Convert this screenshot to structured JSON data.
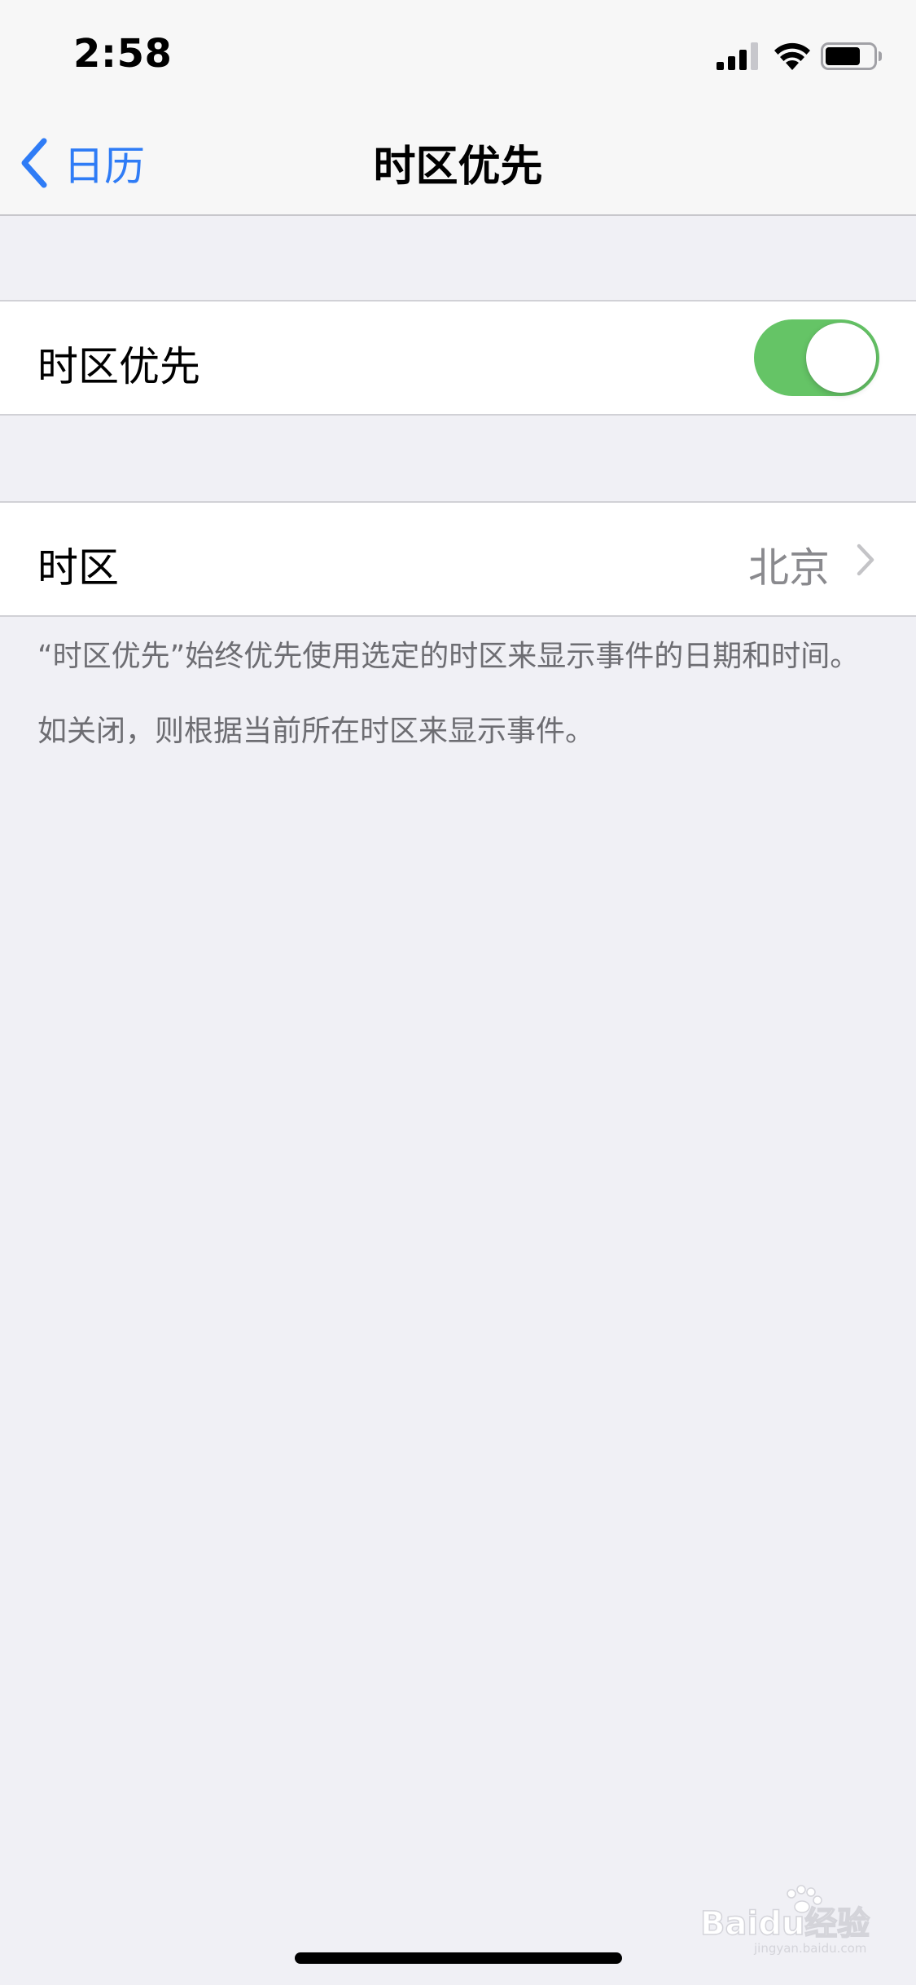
{
  "status_bar": {
    "time": "2:58",
    "icons": [
      "signal-icon",
      "wifi-icon",
      "battery-icon"
    ]
  },
  "nav": {
    "back_label": "日历",
    "title": "时区优先",
    "back_icon": "chevron-left-icon"
  },
  "settings": {
    "toggle_row": {
      "label": "时区优先",
      "toggle_on": true
    },
    "timezone_row": {
      "label": "时区",
      "value": "北京",
      "accessory_icon": "chevron-right-icon"
    }
  },
  "footer": {
    "note_1": "“时区优先”始终优先使用选定的时区来显示事件的日期和时间。",
    "note_2": "如关闭，则根据当前所在时区来显示事件。"
  },
  "watermark": {
    "text": "Baidu经验",
    "subtext": "jingyan.baidu.com"
  },
  "colors": {
    "accent": "#2F7CF6",
    "toggle_on": "#65C466",
    "background": "#F0F0F5",
    "secondary_text": "#8A8A8E"
  }
}
